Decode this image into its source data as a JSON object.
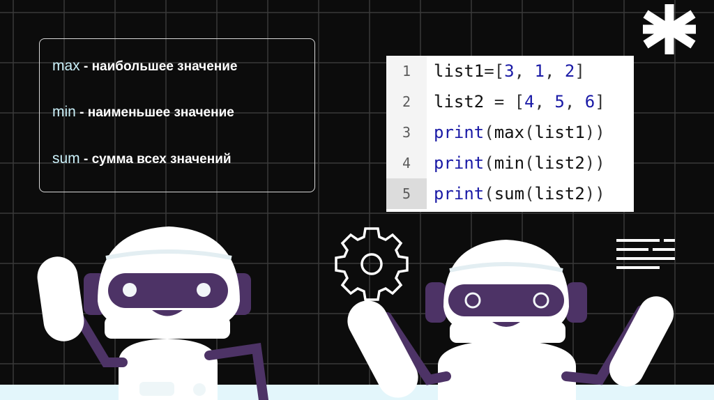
{
  "definitions": [
    {
      "keyword": "max",
      "separator": " - ",
      "text": "наибольшее значение"
    },
    {
      "keyword": "min",
      "separator": " - ",
      "text": "наименьшее значение"
    },
    {
      "keyword": "sum",
      "separator": " - ",
      "text": "сумма всех значений"
    }
  ],
  "code": {
    "line_numbers": [
      "1",
      "2",
      "3",
      "4",
      "5"
    ],
    "lines": [
      [
        {
          "t": "list1",
          "c": "id"
        },
        {
          "t": "=[",
          "c": "pn"
        },
        {
          "t": "3",
          "c": "num"
        },
        {
          "t": ", ",
          "c": "pn"
        },
        {
          "t": "1",
          "c": "num"
        },
        {
          "t": ", ",
          "c": "pn"
        },
        {
          "t": "2",
          "c": "num"
        },
        {
          "t": "]",
          "c": "pn"
        }
      ],
      [
        {
          "t": "list2",
          "c": "id"
        },
        {
          "t": " = [",
          "c": "pn"
        },
        {
          "t": "4",
          "c": "num"
        },
        {
          "t": ", ",
          "c": "pn"
        },
        {
          "t": "5",
          "c": "num"
        },
        {
          "t": ", ",
          "c": "pn"
        },
        {
          "t": "6",
          "c": "num"
        },
        {
          "t": "]",
          "c": "pn"
        }
      ],
      [
        {
          "t": "print",
          "c": "fn"
        },
        {
          "t": "(",
          "c": "pn"
        },
        {
          "t": "max",
          "c": "id"
        },
        {
          "t": "(",
          "c": "pn"
        },
        {
          "t": "list1",
          "c": "id"
        },
        {
          "t": "))",
          "c": "pn"
        }
      ],
      [
        {
          "t": "print",
          "c": "fn"
        },
        {
          "t": "(",
          "c": "pn"
        },
        {
          "t": "min",
          "c": "id"
        },
        {
          "t": "(",
          "c": "pn"
        },
        {
          "t": "list2",
          "c": "id"
        },
        {
          "t": "))",
          "c": "pn"
        }
      ],
      [
        {
          "t": "print",
          "c": "fn"
        },
        {
          "t": "(",
          "c": "pn"
        },
        {
          "t": "sum",
          "c": "id"
        },
        {
          "t": "(",
          "c": "pn"
        },
        {
          "t": "list2",
          "c": "id"
        },
        {
          "t": "))",
          "c": "pn"
        }
      ]
    ],
    "highlighted_line": 5
  },
  "decor": {
    "icons": [
      "asterisk-icon",
      "gear-icon",
      "text-lines-icon"
    ],
    "colors": {
      "background": "#0c0c0c",
      "grid": "#3a3a3a",
      "robot_purple": "#4d3366",
      "robot_white": "#ffffff",
      "floor": "#e3f6fb",
      "keyword": "#ccf2fb",
      "code_blue": "#1a1aa6"
    }
  }
}
